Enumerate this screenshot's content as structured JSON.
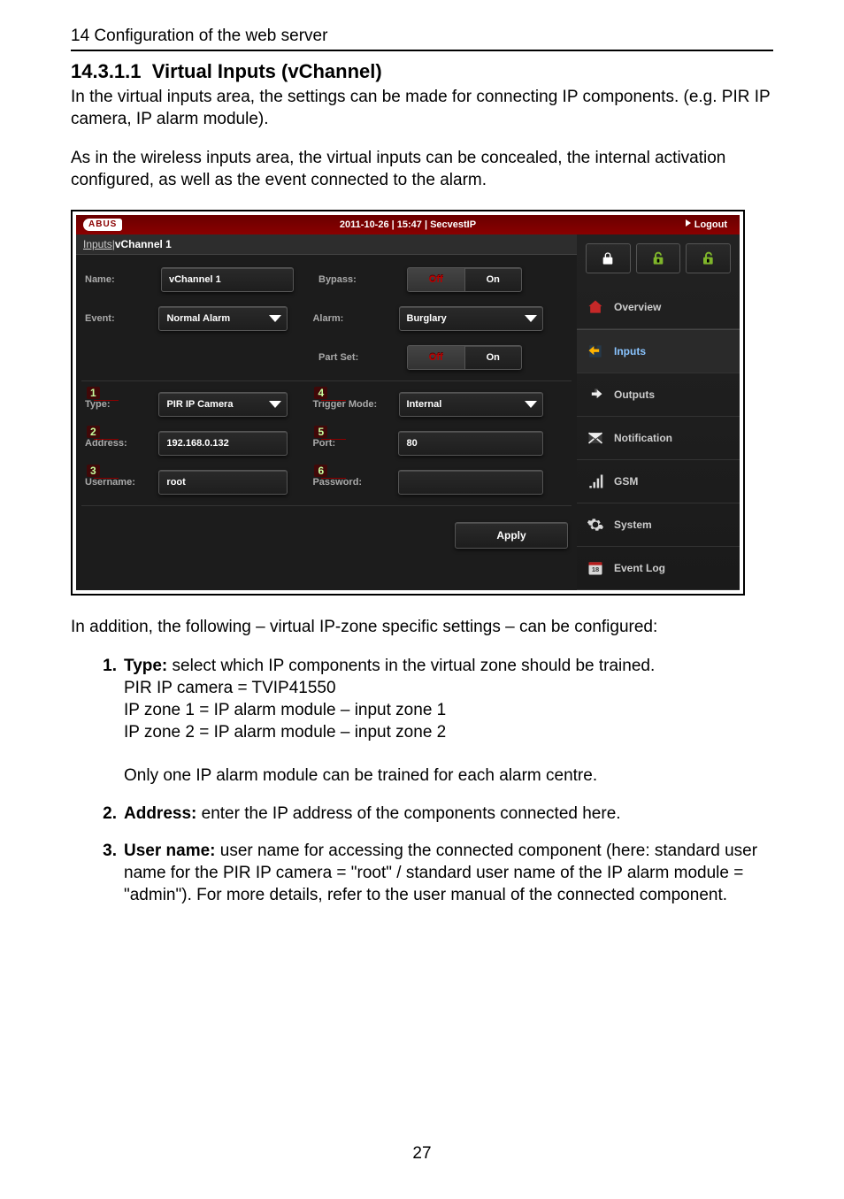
{
  "header": {
    "chapter_line": "14  Configuration of the web server"
  },
  "section": {
    "number": "14.3.1.1",
    "title": "Virtual Inputs (vChannel)"
  },
  "paragraphs": {
    "p1": "In the virtual inputs area, the settings can be made for connecting IP components. (e.g. PIR IP camera, IP alarm module).",
    "p2": "As in the wireless inputs area, the virtual inputs can be concealed, the internal activation configured, as well as the event connected to the alarm.",
    "p3": "In addition, the following – virtual IP-zone specific settings – can be configured:"
  },
  "list": {
    "i1": {
      "num": "1.",
      "lead": "Type:",
      "text": " select which IP components in the virtual zone should be trained.",
      "l1": "PIR IP camera = TVIP41550",
      "l2": "IP zone 1 = IP alarm module – input zone 1",
      "l3": "IP zone 2 = IP alarm module – input zone 2",
      "l4": "Only one IP alarm module can be trained for each alarm centre."
    },
    "i2": {
      "num": "2.",
      "lead": "Address:",
      "text": " enter the IP address of the components connected here."
    },
    "i3": {
      "num": "3.",
      "lead": "User name:",
      "text": " user name for accessing the connected component (here: standard user name for the PIR IP camera = \"root\" / standard user name of the IP alarm module = \"admin\"). For more details, refer to the user manual of the connected component."
    }
  },
  "page_number": "27",
  "shot": {
    "logo": "ABUS",
    "topbar_center": "2011-10-26  |  15:47  |  SecvestIP",
    "logout": "Logout",
    "breadcrumb_a": "Inputs",
    "breadcrumb_sep": " | ",
    "breadcrumb_b": "vChannel 1",
    "labels": {
      "name": "Name:",
      "bypass": "Bypass:",
      "event": "Event:",
      "alarm": "Alarm:",
      "partset": "Part Set:",
      "type": "Type:",
      "trigger": "Trigger Mode:",
      "address": "Address:",
      "port": "Port:",
      "username": "Username:",
      "password": "Password:"
    },
    "values": {
      "name": "vChannel 1",
      "event": "Normal Alarm",
      "alarm": "Burglary",
      "type": "PIR IP Camera",
      "trigger": "Internal",
      "address": "192.168.0.132",
      "port": "80",
      "username": "root",
      "password": ""
    },
    "toggle": {
      "off": "Off",
      "on": "On"
    },
    "apply": "Apply",
    "callouts": {
      "c1": "1",
      "c2": "2",
      "c3": "3",
      "c4": "4",
      "c5": "5",
      "c6": "6"
    },
    "nav": {
      "overview": "Overview",
      "inputs": "Inputs",
      "outputs": "Outputs",
      "notification": "Notification",
      "gsm": "GSM",
      "system": "System",
      "eventlog": "Event Log"
    }
  }
}
